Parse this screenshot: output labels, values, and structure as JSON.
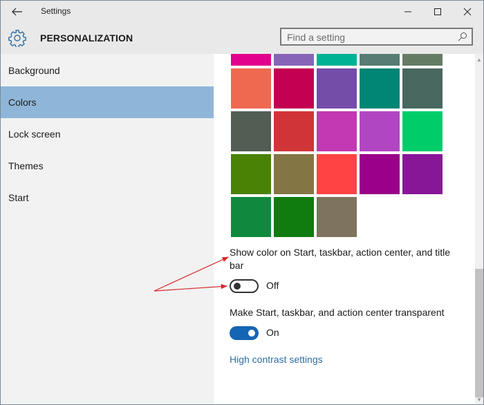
{
  "window": {
    "title": "Settings",
    "back_icon": "arrow-left-icon",
    "controls": {
      "minimize_icon": "minimize-icon",
      "maximize_icon": "maximize-icon",
      "close_icon": "close-icon"
    }
  },
  "header": {
    "icon": "gear-icon",
    "title": "PERSONALIZATION",
    "search": {
      "placeholder": "Find a setting",
      "value": "",
      "icon": "search-icon"
    }
  },
  "sidebar": {
    "items": [
      {
        "label": "Background",
        "active": false
      },
      {
        "label": "Colors",
        "active": true
      },
      {
        "label": "Lock screen",
        "active": false
      },
      {
        "label": "Themes",
        "active": false
      },
      {
        "label": "Start",
        "active": false
      }
    ]
  },
  "colors": {
    "swatches": [
      [
        "#e3008c",
        "#8764b8",
        "#00b294",
        "#567c73",
        "#647c64"
      ],
      [
        "#ef6950",
        "#c30052",
        "#744da9",
        "#018574",
        "#486860"
      ],
      [
        "#525e54",
        "#d13438",
        "#c239b3",
        "#b146c2",
        "#00cc6a"
      ],
      [
        "#498205",
        "#847545",
        "#ff4343",
        "#9a0089",
        "#881798"
      ],
      [
        "#10893e",
        "#107c10",
        "#7e735f"
      ]
    ]
  },
  "settings": {
    "show_color": {
      "label": "Show color on Start, taskbar, action center, and title bar",
      "state": "Off",
      "enabled": false
    },
    "transparent": {
      "label": "Make Start, taskbar, and action center transparent",
      "state": "On",
      "enabled": true
    },
    "high_contrast_link": "High contrast settings"
  },
  "accent_colors": {
    "selected_nav": "#8fb6d8",
    "toggle_on": "#1565b5",
    "link": "#2e6ea3",
    "annotation_arrow": "#d42a2a"
  }
}
